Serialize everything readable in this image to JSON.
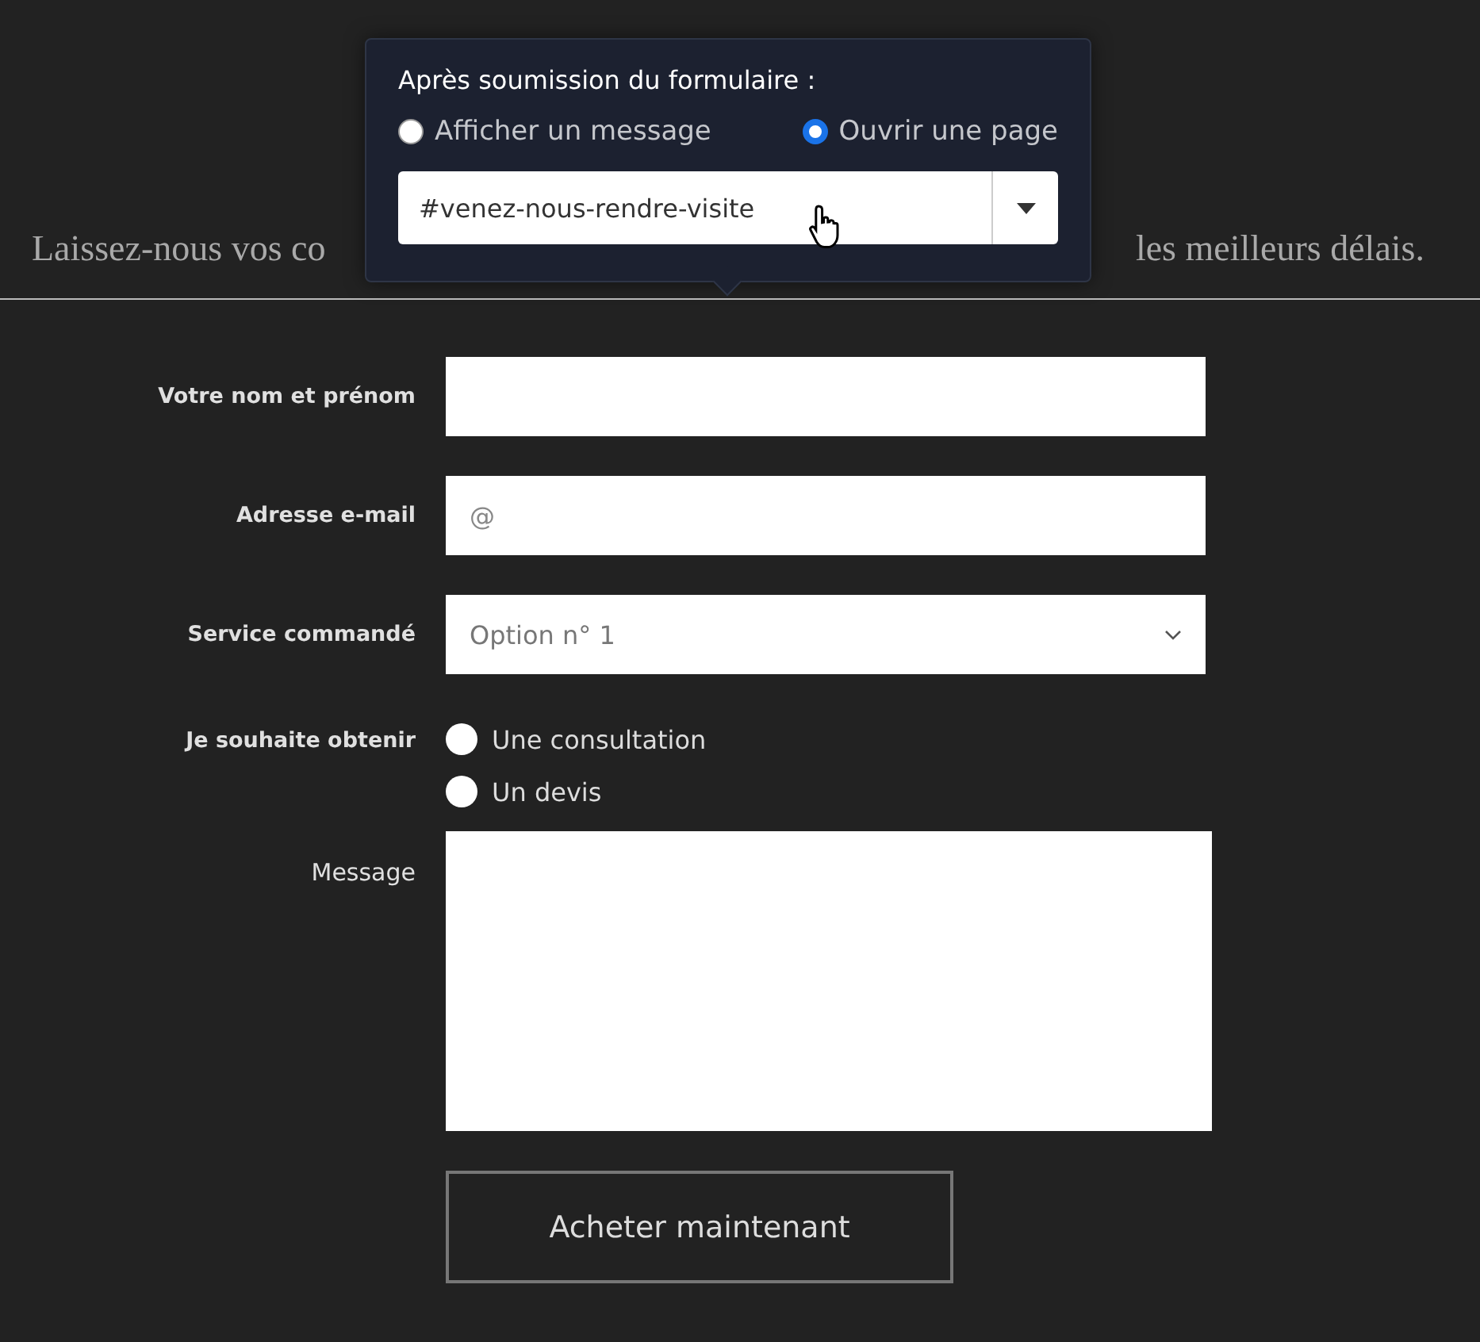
{
  "intro": {
    "left": "Laissez-nous vos co",
    "right": "les meilleurs délais."
  },
  "popover": {
    "title": "Après soumission du formulaire :",
    "options": [
      {
        "label": "Afficher un message",
        "selected": false
      },
      {
        "label": "Ouvrir une page",
        "selected": true
      }
    ],
    "select_value": "#venez-nous-rendre-visite"
  },
  "form": {
    "fields": [
      {
        "kind": "text",
        "label": "Votre nom et prénom",
        "required": true
      },
      {
        "kind": "text",
        "label": "Adresse e-mail",
        "required": true,
        "placeholder": "@"
      },
      {
        "kind": "select",
        "label": "Service commandé",
        "required": true,
        "value": "Option n° 1"
      },
      {
        "kind": "radio",
        "label": "Je souhaite obtenir",
        "required": true,
        "options": [
          {
            "label": "Une consultation",
            "selected": false
          },
          {
            "label": "Un devis",
            "selected": false
          }
        ]
      },
      {
        "kind": "textarea",
        "label": "Message",
        "required": false
      }
    ],
    "submit": "Acheter maintenant"
  }
}
